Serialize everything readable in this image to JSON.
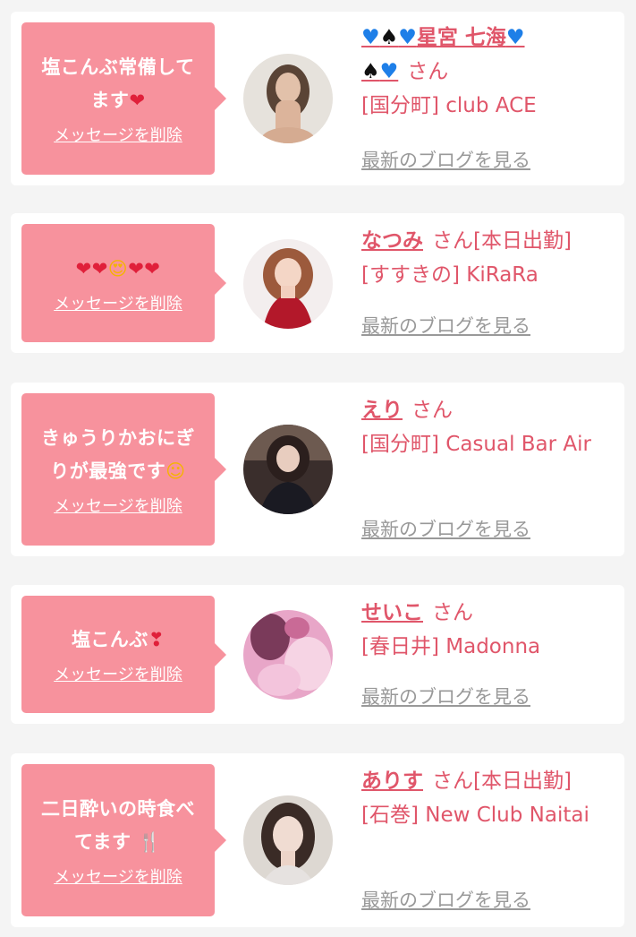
{
  "delete_label": "メッセージを削除",
  "blog_label": "最新のブログを見る",
  "san_label": "さん",
  "items": [
    {
      "message": "塩こんぶ常備してます❤",
      "name": "💙♠💙星宮 七海💙♠💙",
      "name_plain": "星宮 七海",
      "badge": "",
      "shop": "[国分町] club ACE"
    },
    {
      "message": "❤❤😍❤❤",
      "name": "なつみ",
      "badge": "[本日出勤]",
      "shop": "[すすきの] KiRaRa"
    },
    {
      "message": "きゅうりかおにぎりが最強です🥰",
      "name": "えり",
      "badge": "",
      "shop": "[国分町] Casual Bar Air"
    },
    {
      "message": "塩こんぶ❣",
      "name": "せいこ",
      "badge": "",
      "shop": "[春日井] Madonna"
    },
    {
      "message": "二日酔いの時食べてます🍴",
      "name": "ありす",
      "badge": "[本日出勤]",
      "shop": "[石巻] New Club Naitai"
    }
  ],
  "icons": {
    "blue_heart": "blue-heart-icon",
    "spade": "spade-icon",
    "red_heart": "red-heart-icon",
    "heart_eyes": "heart-eyes-icon",
    "smiling_hearts": "smiling-face-with-hearts-icon",
    "heart_exclamation": "heart-exclamation-icon",
    "fork_knife": "fork-and-knife-icon"
  },
  "colors": {
    "accent": "#f7929d",
    "name": "#e0566a",
    "blog": "#999999",
    "background": "#f4f4f4"
  }
}
